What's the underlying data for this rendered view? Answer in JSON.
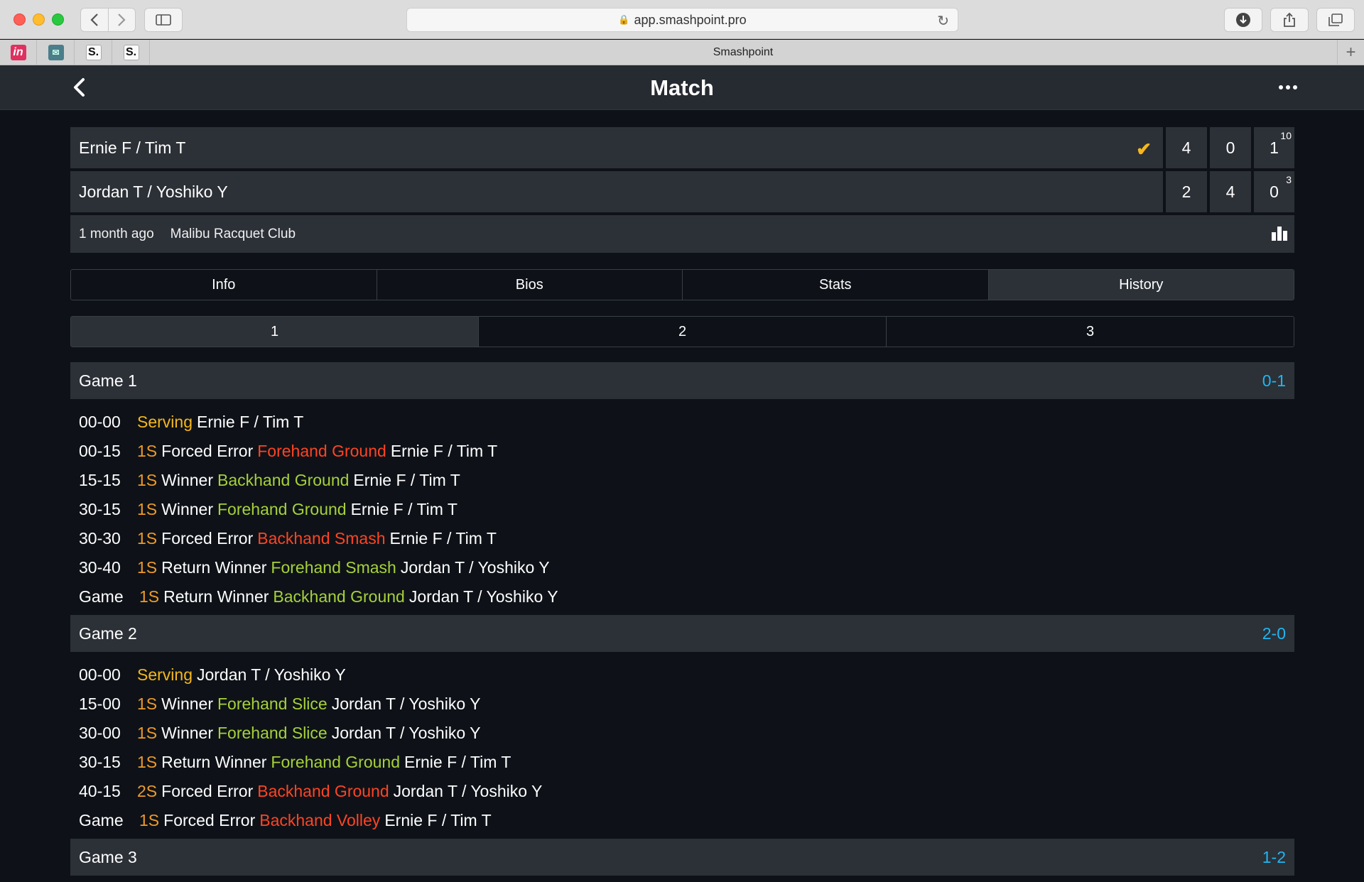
{
  "browser": {
    "url": "app.smashpoint.pro",
    "tab_title": "Smashpoint",
    "bookmarks": [
      {
        "icon": "invision-icon",
        "glyph": "in"
      },
      {
        "icon": "mail-icon",
        "glyph": "✉"
      },
      {
        "icon": "smashpoint-icon",
        "glyph": "S."
      },
      {
        "icon": "smashpoint-icon",
        "glyph": "S."
      }
    ]
  },
  "header": {
    "title": "Match"
  },
  "match": {
    "teams": [
      {
        "name": "Ernie F / Tim T",
        "winner": true,
        "sets": [
          "4",
          "0",
          "1"
        ],
        "tiebreak": "10"
      },
      {
        "name": "Jordan T / Yoshiko Y",
        "winner": false,
        "sets": [
          "2",
          "4",
          "0"
        ],
        "tiebreak": "3"
      }
    ],
    "when": "1 month ago",
    "venue": "Malibu Racquet Club"
  },
  "tabs": [
    "Info",
    "Bios",
    "Stats",
    "History"
  ],
  "active_tab": "History",
  "set_tabs": [
    "1",
    "2",
    "3"
  ],
  "active_set": "1",
  "games": [
    {
      "title": "Game 1",
      "score": "0-1",
      "points": [
        {
          "score": "00-00",
          "serve": "",
          "kind": "Serving",
          "shot": "",
          "team": "Ernie F / Tim T",
          "shot_color": ""
        },
        {
          "score": "00-15",
          "serve": "1S",
          "kind": "Forced Error",
          "shot": "Forehand Ground",
          "team": "Ernie F / Tim T",
          "shot_color": "red"
        },
        {
          "score": "15-15",
          "serve": "1S",
          "kind": "Winner",
          "shot": "Backhand Ground",
          "team": "Ernie F / Tim T",
          "shot_color": "green"
        },
        {
          "score": "30-15",
          "serve": "1S",
          "kind": "Winner",
          "shot": "Forehand Ground",
          "team": "Ernie F / Tim T",
          "shot_color": "green"
        },
        {
          "score": "30-30",
          "serve": "1S",
          "kind": "Forced Error",
          "shot": "Backhand Smash",
          "team": "Ernie F / Tim T",
          "shot_color": "red"
        },
        {
          "score": "30-40",
          "serve": "1S",
          "kind": "Return Winner",
          "shot": "Forehand Smash",
          "team": "Jordan T / Yoshiko Y",
          "shot_color": "green"
        },
        {
          "score": "Game",
          "serve": "1S",
          "kind": "Return Winner",
          "shot": "Backhand Ground",
          "team": "Jordan T / Yoshiko Y",
          "shot_color": "green"
        }
      ]
    },
    {
      "title": "Game 2",
      "score": "2-0",
      "points": [
        {
          "score": "00-00",
          "serve": "",
          "kind": "Serving",
          "shot": "",
          "team": "Jordan T / Yoshiko Y",
          "shot_color": ""
        },
        {
          "score": "15-00",
          "serve": "1S",
          "kind": "Winner",
          "shot": "Forehand Slice",
          "team": "Jordan T / Yoshiko Y",
          "shot_color": "green"
        },
        {
          "score": "30-00",
          "serve": "1S",
          "kind": "Winner",
          "shot": "Forehand Slice",
          "team": "Jordan T / Yoshiko Y",
          "shot_color": "green"
        },
        {
          "score": "30-15",
          "serve": "1S",
          "kind": "Return Winner",
          "shot": "Forehand Ground",
          "team": "Ernie F / Tim T",
          "shot_color": "green"
        },
        {
          "score": "40-15",
          "serve": "2S",
          "kind": "Forced Error",
          "shot": "Backhand Ground",
          "team": "Jordan T / Yoshiko Y",
          "shot_color": "red"
        },
        {
          "score": "Game",
          "serve": "1S",
          "kind": "Forced Error",
          "shot": "Backhand Volley",
          "team": "Ernie F / Tim T",
          "shot_color": "red"
        }
      ]
    },
    {
      "title": "Game 3",
      "score": "1-2",
      "points": []
    }
  ],
  "colors": {
    "background": "#0e1218",
    "panel": "#2c3037",
    "accent_blue": "#1fb6f0",
    "serving_yellow": "#f5b71c",
    "serve_orange": "#ee9a2a",
    "winner_green": "#a6d13a",
    "error_red": "#ff4422"
  }
}
